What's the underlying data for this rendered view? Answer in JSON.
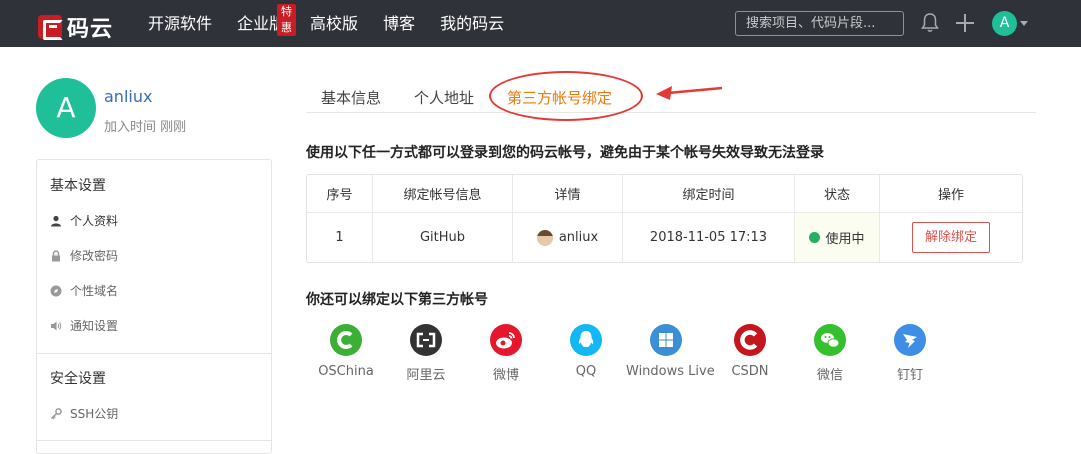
{
  "header": {
    "brand": "码云",
    "nav": [
      "开源软件",
      "企业版",
      "高校版",
      "博客",
      "我的码云"
    ],
    "enterprise_badge": "特惠",
    "search_placeholder": "搜索项目、代码片段...",
    "avatar_letter": "A"
  },
  "profile": {
    "avatar_letter": "A",
    "username": "anliux",
    "join_text": "加入时间 刚刚"
  },
  "sidebar": {
    "basic_heading": "基本设置",
    "basic_items": [
      "个人资料",
      "修改密码",
      "个性域名",
      "通知设置"
    ],
    "security_heading": "安全设置",
    "security_items": [
      "SSH公钥"
    ]
  },
  "tabs": [
    "基本信息",
    "个人地址",
    "第三方帐号绑定"
  ],
  "bind_notice": "使用以下任一方式都可以登录到您的码云帐号，避免由于某个帐号失效导致无法登录",
  "table": {
    "headers": [
      "序号",
      "绑定帐号信息",
      "详情",
      "绑定时间",
      "状态",
      "操作"
    ],
    "row": {
      "index": "1",
      "account": "GitHub",
      "detail": "anliux",
      "time": "2018-11-05 17:13",
      "status": "使用中",
      "action": "解除绑定"
    }
  },
  "more_heading": "你还可以绑定以下第三方帐号",
  "providers": [
    {
      "name": "OSChina",
      "icon": "oschina-icon",
      "color": "#3cb034"
    },
    {
      "name": "阿里云",
      "icon": "aliyun-icon",
      "color": "#333333"
    },
    {
      "name": "微博",
      "icon": "weibo-icon",
      "color": "#e6162d"
    },
    {
      "name": "QQ",
      "icon": "qq-icon",
      "color": "#12b7f5"
    },
    {
      "name": "Windows Live",
      "icon": "windows-icon",
      "color": "#3b8fd7"
    },
    {
      "name": "CSDN",
      "icon": "csdn-icon",
      "color": "#c4161c"
    },
    {
      "name": "微信",
      "icon": "wechat-icon",
      "color": "#35c02d"
    },
    {
      "name": "钉钉",
      "icon": "dingtalk-icon",
      "color": "#3e8ee6"
    }
  ],
  "colors": {
    "topbar": "#2f3239",
    "accent_orange": "#e77b0c",
    "danger": "#d9534f",
    "avatar_green": "#1fbf9a",
    "status_green": "#27ae60"
  }
}
